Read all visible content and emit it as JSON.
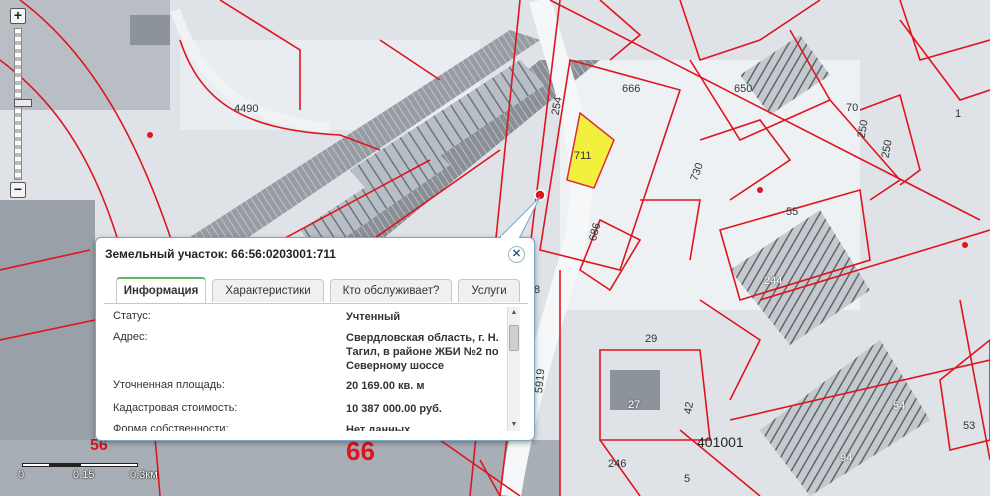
{
  "map": {
    "labels": [
      "4490",
      "666",
      "254",
      "650",
      "70",
      "250",
      "250",
      "1",
      "711",
      "730",
      "55",
      "686",
      "244",
      "29",
      "5919",
      "27",
      "42",
      "54",
      "53",
      "401001",
      "246",
      "5",
      "94",
      "8",
      "56",
      "66"
    ],
    "parcel_highlight_color": "#f2f02a",
    "border_color": "#e0141e"
  },
  "zoom": {
    "plus": "+",
    "minus": "−"
  },
  "scale": {
    "labels": [
      "0",
      "0.15",
      "0.3км"
    ]
  },
  "popup": {
    "title": "Земельный участок: 66:56:0203001:711",
    "close_icon": "✕",
    "tabs": [
      {
        "label": "Информация"
      },
      {
        "label": "Характеристики"
      },
      {
        "label": "Кто обслуживает?"
      },
      {
        "label": "Услуги"
      }
    ],
    "rows": [
      {
        "key": "Статус:",
        "value": "Учтенный"
      },
      {
        "key": "Адрес:",
        "value": "Свердловская область, г. Н. Тагил, в районе ЖБИ №2 по Северному шоссе"
      },
      {
        "key": "Уточненная площадь:",
        "value": "20 169.00 кв. м"
      },
      {
        "key": "Кадастровая стоимость:",
        "value": "10 387 000.00 руб."
      },
      {
        "key": "Форма собственности:",
        "value": "Нет данных"
      }
    ],
    "scroll_up": "▲",
    "scroll_down": "▼"
  }
}
